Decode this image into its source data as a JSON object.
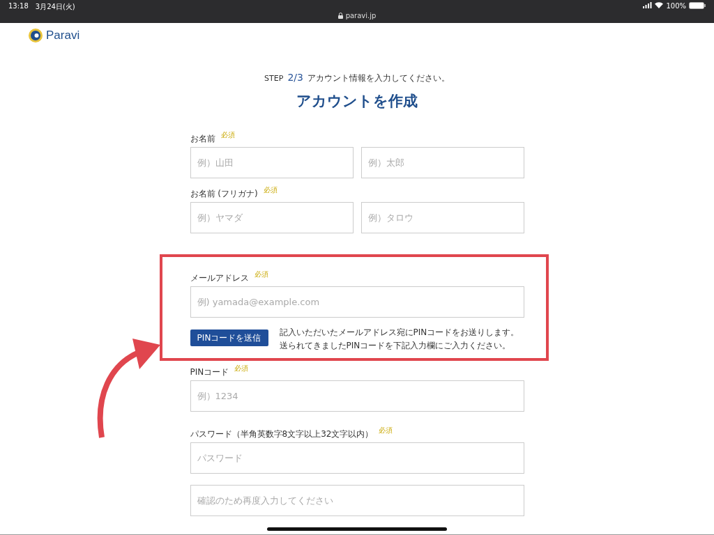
{
  "status_bar": {
    "time": "13:18",
    "date": "3月24日(火)",
    "url": "paravi.jp",
    "battery": "100%"
  },
  "logo": {
    "text": "Paravi"
  },
  "step": {
    "label": "STEP",
    "number": "2/3",
    "text": "アカウント情報を入力してください。"
  },
  "title": "アカウントを作成",
  "sections": [
    {
      "kind": "pair",
      "highlighted": false,
      "label": "お名前",
      "badge": "必須",
      "placeholders": [
        "例）山田",
        "例）太郎"
      ]
    },
    {
      "kind": "pair",
      "highlighted": false,
      "label": "お名前 (フリガナ)",
      "badge": "必須",
      "placeholders": [
        "例）ヤマダ",
        "例）タロウ"
      ]
    },
    {
      "kind": "email",
      "highlighted": true,
      "label": "メールアドレス",
      "badge": "必須",
      "placeholders": [
        "例) yamada@example.com"
      ],
      "button": "PINコードを送信",
      "note_lines": [
        "記入いただいたメールアドレス宛にPINコードをお送りします。",
        "送られてきましたPINコードを下記入力欄にご入力ください。"
      ]
    },
    {
      "kind": "stack",
      "highlighted": false,
      "label": "PINコード",
      "badge": "必須",
      "placeholders": [
        "例）1234"
      ]
    },
    {
      "kind": "stack",
      "highlighted": false,
      "label": "パスワード（半角英数字8文字以上32文字以内）",
      "badge": "必須",
      "placeholders": [
        "パスワード",
        "確認のため再度入力してください"
      ]
    }
  ]
}
